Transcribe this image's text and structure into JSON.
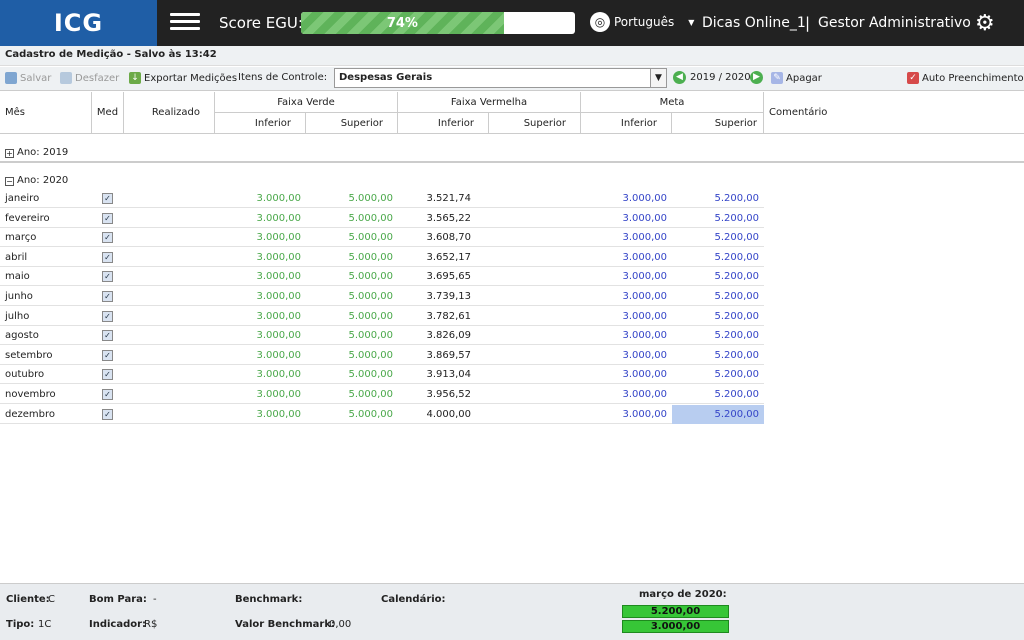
{
  "header": {
    "logo": "ICG",
    "score_label": "Score EGU:",
    "score_value": "74%",
    "score_fraction": 0.74,
    "language": "Português",
    "user": "Dicas Online_1",
    "separator": "|",
    "role": "Gestor Administrativo"
  },
  "page": {
    "title": "Cadastro de Medição - Salvo às 13:42"
  },
  "toolbar": {
    "save": "Salvar",
    "undo": "Desfazer",
    "export": "Exportar Medições",
    "items_label": "Itens de Controle:",
    "items_value": "Despesas Gerais",
    "year_range": "2019 / 2020",
    "delete": "Apagar",
    "auto_fill": "Auto Preenchimento"
  },
  "grid": {
    "headers": {
      "mes": "Mês",
      "med": "Med",
      "realizado": "Realizado",
      "faixa_verde": "Faixa Verde",
      "faixa_vermelha": "Faixa Vermelha",
      "meta": "Meta",
      "comentario": "Comentário",
      "inferior": "Inferior",
      "superior": "Superior"
    },
    "groups": [
      "Ano: 2019",
      "Ano: 2020"
    ],
    "rows": [
      {
        "mes": "janeiro",
        "realizado": "3.521,74",
        "verde_inf": "3.000,00",
        "verde_sup": "5.000,00",
        "meta_inf": "3.000,00",
        "meta_sup": "5.200,00"
      },
      {
        "mes": "fevereiro",
        "realizado": "3.565,22",
        "verde_inf": "3.000,00",
        "verde_sup": "5.000,00",
        "meta_inf": "3.000,00",
        "meta_sup": "5.200,00"
      },
      {
        "mes": "março",
        "realizado": "3.608,70",
        "verde_inf": "3.000,00",
        "verde_sup": "5.000,00",
        "meta_inf": "3.000,00",
        "meta_sup": "5.200,00"
      },
      {
        "mes": "abril",
        "realizado": "3.652,17",
        "verde_inf": "3.000,00",
        "verde_sup": "5.000,00",
        "meta_inf": "3.000,00",
        "meta_sup": "5.200,00"
      },
      {
        "mes": "maio",
        "realizado": "3.695,65",
        "verde_inf": "3.000,00",
        "verde_sup": "5.000,00",
        "meta_inf": "3.000,00",
        "meta_sup": "5.200,00"
      },
      {
        "mes": "junho",
        "realizado": "3.739,13",
        "verde_inf": "3.000,00",
        "verde_sup": "5.000,00",
        "meta_inf": "3.000,00",
        "meta_sup": "5.200,00"
      },
      {
        "mes": "julho",
        "realizado": "3.782,61",
        "verde_inf": "3.000,00",
        "verde_sup": "5.000,00",
        "meta_inf": "3.000,00",
        "meta_sup": "5.200,00"
      },
      {
        "mes": "agosto",
        "realizado": "3.826,09",
        "verde_inf": "3.000,00",
        "verde_sup": "5.000,00",
        "meta_inf": "3.000,00",
        "meta_sup": "5.200,00"
      },
      {
        "mes": "setembro",
        "realizado": "3.869,57",
        "verde_inf": "3.000,00",
        "verde_sup": "5.000,00",
        "meta_inf": "3.000,00",
        "meta_sup": "5.200,00"
      },
      {
        "mes": "outubro",
        "realizado": "3.913,04",
        "verde_inf": "3.000,00",
        "verde_sup": "5.000,00",
        "meta_inf": "3.000,00",
        "meta_sup": "5.200,00"
      },
      {
        "mes": "novembro",
        "realizado": "3.956,52",
        "verde_inf": "3.000,00",
        "verde_sup": "5.000,00",
        "meta_inf": "3.000,00",
        "meta_sup": "5.200,00"
      },
      {
        "mes": "dezembro",
        "realizado": "4.000,00",
        "verde_inf": "3.000,00",
        "verde_sup": "5.000,00",
        "meta_inf": "3.000,00",
        "meta_sup": "5.200,00"
      }
    ]
  },
  "footer": {
    "cliente_label": "Cliente:",
    "cliente_value": "C",
    "tipo_label": "Tipo:",
    "tipo_value": "1C",
    "bom_para_label": "Bom Para:",
    "bom_para_value": "-",
    "indicador_label": "Indicador:",
    "indicador_value": "R$",
    "benchmark_label": "Benchmark:",
    "valor_benchmark_label": "Valor Benchmark:",
    "valor_benchmark_value": "0,00",
    "calendario_label": "Calendário:",
    "month_title": "março de 2020:",
    "month_meta": "5.200,00",
    "month_inferior": "3.000,00"
  },
  "colors": {
    "topbar": "#222222",
    "logo_bg": "#1f5ea6",
    "green_text": "#4aa84a",
    "blue_text": "#3545c8",
    "selected_cell": "#b8cdf0",
    "footer_green": "#37c637"
  }
}
